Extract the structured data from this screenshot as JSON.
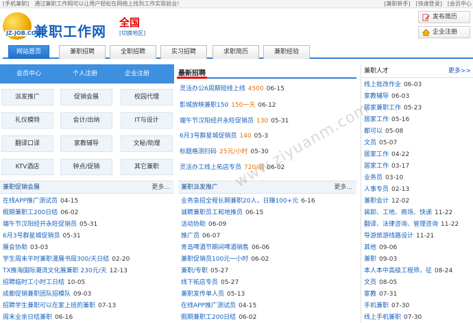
{
  "topbar": {
    "left": "[手机兼职]　通过兼职工作网可以让用户轻松在网络上找到工作实现就业!",
    "right": "[兼职新手]　[快速登录]　[会员中心"
  },
  "logo": {
    "mark_text": "JZ-JOB.COM",
    "word": "兼职工作网"
  },
  "city": {
    "name": "全国",
    "switch": "[切换地区]"
  },
  "actions": {
    "publish": "发布简历",
    "corp": "企业注册"
  },
  "nav": {
    "tabs": [
      "网站首页",
      "兼职招聘",
      "全职招聘",
      "实习招聘",
      "求职简历",
      "兼职经验"
    ]
  },
  "left_header": [
    "会员中心",
    "个人注册",
    "企业注册"
  ],
  "categories": [
    "派发推广",
    "促销会展",
    "校园代理",
    "礼仪模特",
    "会计/出纳",
    "IT与设计",
    "翻译口译",
    "家教辅导",
    "文秘/助理",
    "KTV酒店",
    "钟点/促销",
    "其它兼职"
  ],
  "mid": {
    "title": "最新招聘",
    "items": [
      {
        "t": "灵活办公6周期短线上线",
        "s": "4500",
        "d": "06-15"
      },
      {
        "t": "影城放映兼职150",
        "s": "150一天",
        "d": "06-12"
      },
      {
        "t": "端午节汉阳经开永旺促销员",
        "s": "130",
        "d": "05-31"
      },
      {
        "t": "6月3号群星城促销员",
        "s": "140",
        "d": "05-3"
      },
      {
        "t": "标题格测扫码",
        "s": "25元/小时",
        "d": "05-30"
      },
      {
        "t": "灵活办工线上拓店专员",
        "s": "720/周",
        "d": "06-02"
      }
    ]
  },
  "promo": {
    "title": "兼职促销会展",
    "more": "更多...",
    "items": [
      {
        "t": "在线APP推广测试员",
        "d": "04-15"
      },
      {
        "t": "假期兼职工200日结",
        "d": "06-02"
      },
      {
        "t": "端午节汉阳经开永旺促销员",
        "d": "05-31"
      },
      {
        "t": "6月3号群星城促销员",
        "d": "05-31"
      },
      {
        "t": "展会协助",
        "d": "03-03"
      },
      {
        "t": "学生周末平时兼职漫展书局300/天日结",
        "d": "02-20"
      },
      {
        "t": "TX推海国际潮流文化展兼职 230元/天",
        "d": "12-13"
      },
      {
        "t": "招聘临时工小时工日结",
        "d": "10-05"
      },
      {
        "t": "成都促销兼职团队招模队",
        "d": "09-03"
      },
      {
        "t": "招聘学生兼职可以在家上班的兼职",
        "d": "07-13"
      },
      {
        "t": "周末业余日结兼职",
        "d": "06-16"
      }
    ]
  },
  "dispatch": {
    "title": "兼职派发推广",
    "more": "更多...",
    "items": [
      {
        "t": "业务急招全程长期兼职20人，日赚100+元",
        "d": "6-16"
      },
      {
        "t": "诚聘兼职员工和地推员",
        "d": "06-15"
      },
      {
        "t": "活动协助",
        "d": "06-09"
      },
      {
        "t": "推广员",
        "d": "06-07"
      },
      {
        "t": "青岛啤酒节期间啤酒销售",
        "d": "06-06"
      },
      {
        "t": "兼职促销员100元一小时",
        "d": "06-02"
      },
      {
        "t": "兼职/专职",
        "d": "05-27"
      },
      {
        "t": "线下拓店专员",
        "d": "05-27"
      },
      {
        "t": "兼职发传单人员",
        "d": "05-13"
      },
      {
        "t": "在线APP推广测试员",
        "d": "04-15"
      },
      {
        "t": "假期兼职工200日结",
        "d": "06-02"
      }
    ]
  },
  "talent": {
    "title": "兼职人才",
    "more": "更多>>",
    "items": [
      {
        "t": "线上批改作业",
        "d": "06-03"
      },
      {
        "t": "家教辅导",
        "d": "06-03"
      },
      {
        "t": "居家兼职工作",
        "d": "05-23"
      },
      {
        "t": "居家工作",
        "d": "05-16"
      },
      {
        "t": "都可以",
        "d": "05-08"
      },
      {
        "t": "文员",
        "d": "05-07"
      },
      {
        "t": "居家工作",
        "d": "04-22"
      },
      {
        "t": "居家工作",
        "d": "03-17"
      },
      {
        "t": "业务员",
        "d": "03-10"
      },
      {
        "t": "人事专员",
        "d": "02-13"
      },
      {
        "t": "兼职会计",
        "d": "12-02"
      },
      {
        "t": "装卸、工地、商场、快递",
        "d": "11-22"
      },
      {
        "t": "翻译、法律咨询、管理咨询",
        "d": "11-22"
      },
      {
        "t": "导游旅游线路设计",
        "d": "11-21"
      },
      {
        "t": "其他",
        "d": "09-06"
      },
      {
        "t": "兼职",
        "d": "09-03"
      },
      {
        "t": "本人本中高级工程师，征",
        "d": "08-24"
      },
      {
        "t": "文员",
        "d": "08-05"
      },
      {
        "t": "家教",
        "d": "07-31"
      },
      {
        "t": "手机兼职",
        "d": "07-30"
      },
      {
        "t": "线上手机兼职",
        "d": "07-30"
      }
    ]
  },
  "watermark": "www.ziyuanm.com"
}
